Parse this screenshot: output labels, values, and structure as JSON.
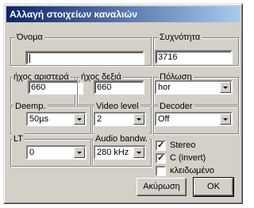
{
  "window": {
    "title": "Αλλαγή στοιχείων καναλιών"
  },
  "fields": {
    "name": {
      "label": "Όνομα",
      "value": ""
    },
    "frequency": {
      "label": "Συχνότητα",
      "value": "3716"
    },
    "audio_left": {
      "label": "ήχος αριστερά",
      "value": "660"
    },
    "audio_right": {
      "label": "ήχος δεξιά",
      "value": "660"
    },
    "polarization": {
      "label": "Πόλωση",
      "value": "hor"
    },
    "deemp": {
      "label": "Deemp.",
      "value": "50µs"
    },
    "video_level": {
      "label": "Video level",
      "value": "2"
    },
    "decoder": {
      "label": "Decoder",
      "value": "Off"
    },
    "lt": {
      "label": "LT",
      "value": "0"
    },
    "audio_bandw": {
      "label": "Audio bandw.",
      "value": "280 kHz"
    }
  },
  "checkboxes": {
    "stereo": {
      "label": "Stereo",
      "checked": true
    },
    "c_invert": {
      "label": "C (invert)",
      "checked": true
    },
    "locked": {
      "label": "κλειδωμένο",
      "checked": false
    }
  },
  "buttons": {
    "cancel": "Ακύρωση",
    "ok": "OK"
  },
  "glyphs": {
    "check": "✓"
  }
}
